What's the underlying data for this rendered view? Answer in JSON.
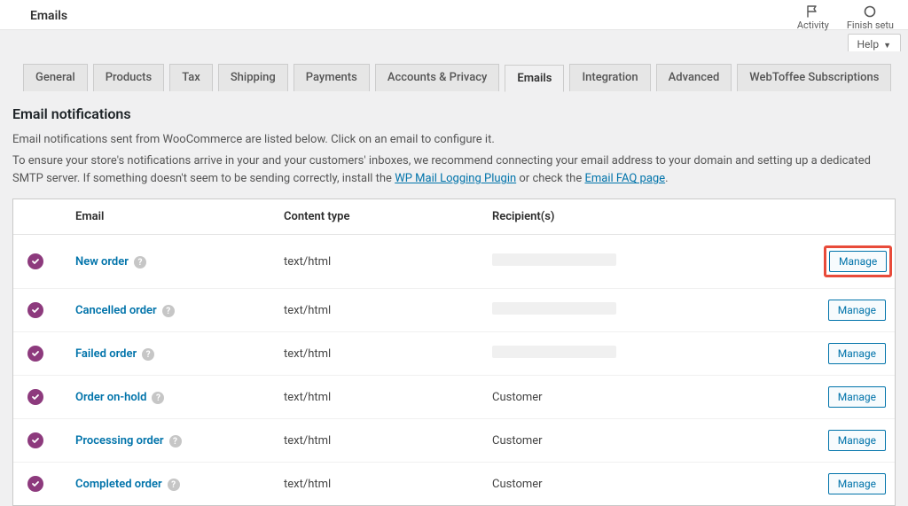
{
  "header": {
    "title": "Emails",
    "activity_label": "Activity",
    "finish_label": "Finish setu",
    "help_label": "Help"
  },
  "tabs": [
    {
      "label": "General",
      "active": false
    },
    {
      "label": "Products",
      "active": false
    },
    {
      "label": "Tax",
      "active": false
    },
    {
      "label": "Shipping",
      "active": false
    },
    {
      "label": "Payments",
      "active": false
    },
    {
      "label": "Accounts & Privacy",
      "active": false
    },
    {
      "label": "Emails",
      "active": true
    },
    {
      "label": "Integration",
      "active": false
    },
    {
      "label": "Advanced",
      "active": false
    },
    {
      "label": "WebToffee Subscriptions",
      "active": false
    }
  ],
  "section": {
    "heading": "Email notifications",
    "desc_line1": "Email notifications sent from WooCommerce are listed below. Click on an email to configure it.",
    "desc_line2_pre": "To ensure your store's notifications arrive in your and your customers' inboxes, we recommend connecting your email address to your domain and setting up a dedicated SMTP server. If something doesn't seem to be sending correctly, install the ",
    "desc_link1": "WP Mail Logging Plugin",
    "desc_mid": " or check the ",
    "desc_link2": "Email FAQ page",
    "desc_end": "."
  },
  "columns": {
    "status": "",
    "email": "Email",
    "content": "Content type",
    "recipient": "Recipient(s)",
    "manage": ""
  },
  "rows": [
    {
      "name": "New order",
      "content": "text/html",
      "recipient": "",
      "redacted": true,
      "highlight": true
    },
    {
      "name": "Cancelled order",
      "content": "text/html",
      "recipient": "",
      "redacted": true,
      "highlight": false
    },
    {
      "name": "Failed order",
      "content": "text/html",
      "recipient": "",
      "redacted": true,
      "highlight": false
    },
    {
      "name": "Order on-hold",
      "content": "text/html",
      "recipient": "Customer",
      "redacted": false,
      "highlight": false
    },
    {
      "name": "Processing order",
      "content": "text/html",
      "recipient": "Customer",
      "redacted": false,
      "highlight": false
    },
    {
      "name": "Completed order",
      "content": "text/html",
      "recipient": "Customer",
      "redacted": false,
      "highlight": false
    }
  ],
  "labels": {
    "manage": "Manage",
    "help_glyph": "?"
  }
}
